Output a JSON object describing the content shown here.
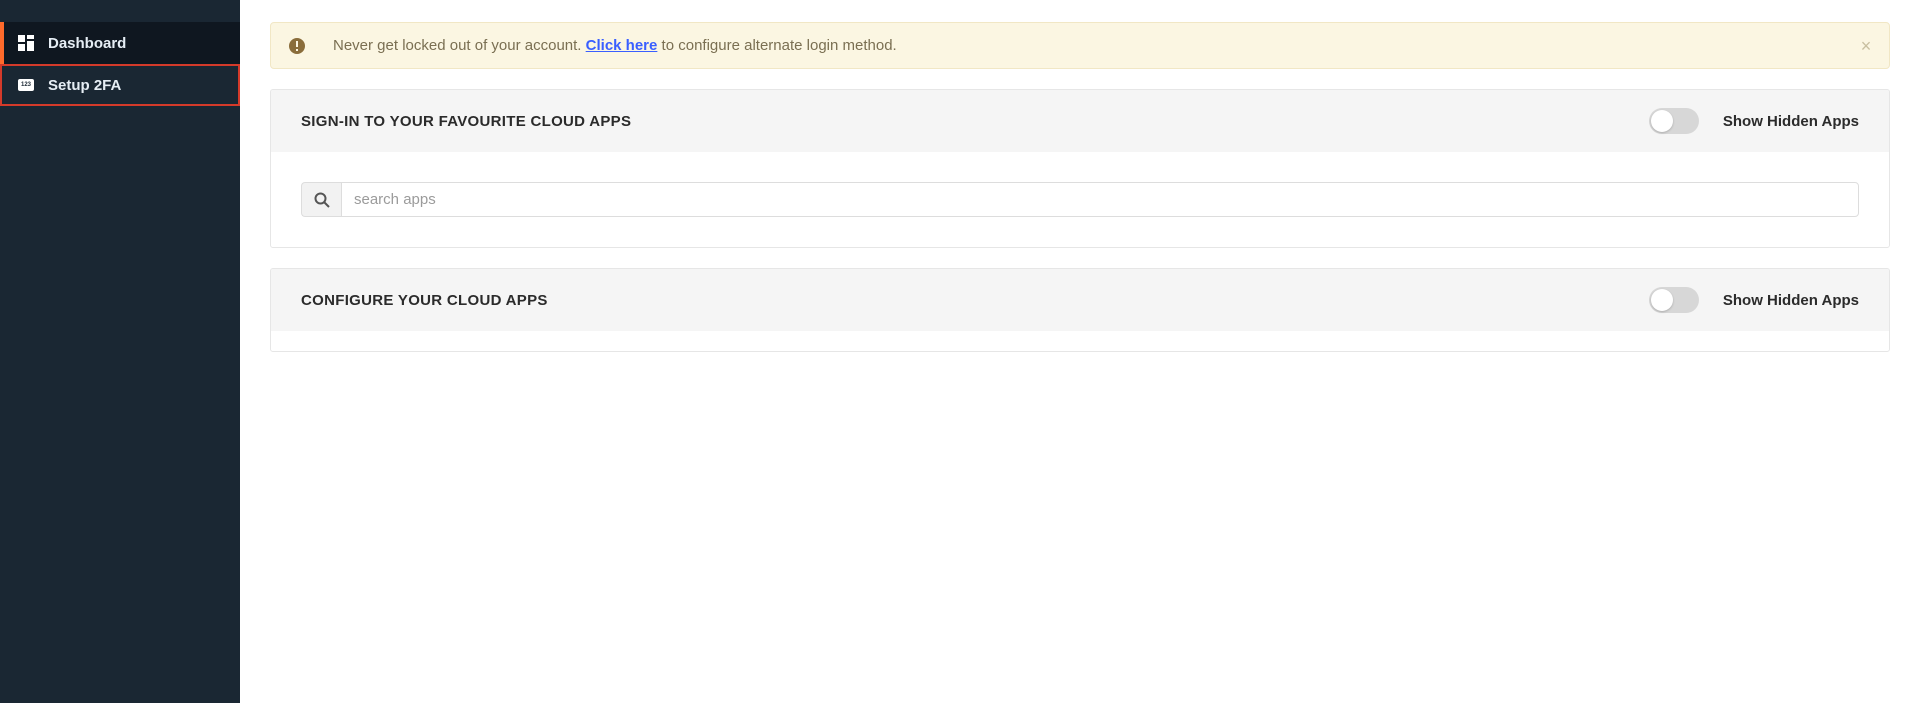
{
  "sidebar": {
    "items": [
      {
        "label": "Dashboard"
      },
      {
        "label": "Setup 2FA"
      }
    ]
  },
  "alert": {
    "text_before": "Never get locked out of your account. ",
    "link_text": "Click here",
    "text_after": " to configure alternate login method."
  },
  "signin_panel": {
    "title": "SIGN-IN TO YOUR FAVOURITE CLOUD APPS",
    "toggle_label": "Show Hidden Apps",
    "search_placeholder": "search apps"
  },
  "configure_panel": {
    "title": "CONFIGURE YOUR CLOUD APPS",
    "toggle_label": "Show Hidden Apps"
  }
}
